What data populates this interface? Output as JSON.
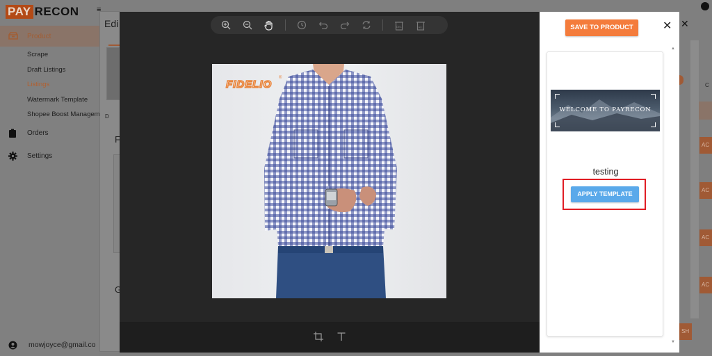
{
  "brand": {
    "logo_left": "PAY",
    "logo_right": "RECON"
  },
  "sidebar": {
    "product_label": "Product",
    "sub_items": [
      "Scrape",
      "Draft Listings",
      "Listings",
      "Watermark Template",
      "Shopee Boost Managem"
    ],
    "orders_label": "Orders",
    "settings_label": "Settings",
    "user_email": "mowjoyce@gmail.co"
  },
  "background": {
    "edit_title": "Edi",
    "letter_d": "D",
    "letter_f": "F",
    "letter_g": "G",
    "col_letter_c": "C",
    "ac_label": "AC",
    "sh_label": "SH",
    "close_glyph": "✕"
  },
  "editor": {
    "toolbar_icons": [
      "zoom-in-icon",
      "zoom-out-icon",
      "hand-pan-icon",
      "history-icon",
      "undo-icon",
      "redo-icon",
      "reset-icon",
      "delete-icon",
      "delete-all-icon"
    ],
    "delete_label": "DEL",
    "delete_all_label": "ALL",
    "bottom_icons": [
      "crop-icon",
      "text-icon"
    ],
    "watermark_text": "FIDELIO",
    "registered_mark": "®"
  },
  "panel": {
    "save_label": "SAVE TO PRODUCT",
    "close_glyph": "✕",
    "banner_text": "WELCOME TO PAYRECON",
    "template_name": "testing",
    "apply_label": "APPLY TEMPLATE"
  },
  "colors": {
    "accent_orange": "#f47c3c",
    "apply_blue": "#5aa9ea",
    "highlight_red": "#e01d24",
    "editor_bg": "#262626"
  }
}
